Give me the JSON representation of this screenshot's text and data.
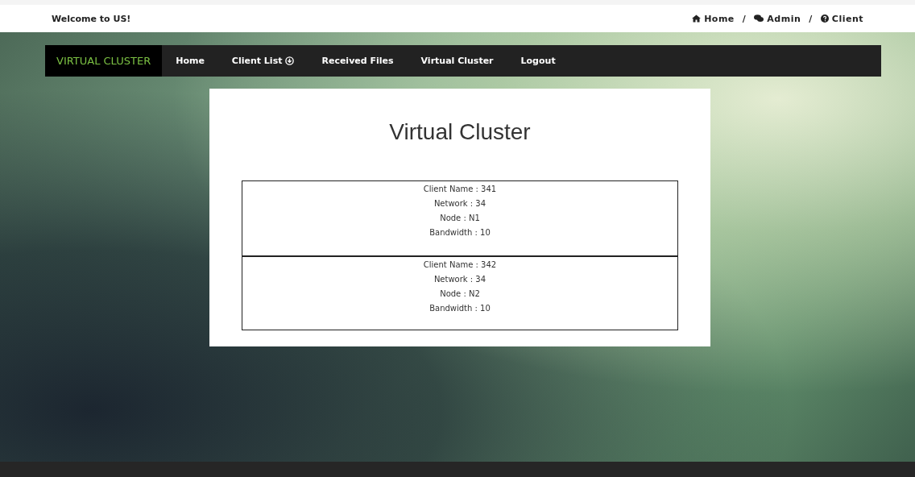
{
  "header": {
    "welcome": "Welcome to US!",
    "separator": "/",
    "breadcrumb": [
      {
        "kind": "home",
        "label": "Home"
      },
      {
        "kind": "chat",
        "label": "Admin"
      },
      {
        "kind": "help",
        "label": "Client"
      }
    ]
  },
  "nav": {
    "brand": "VIRTUAL CLUSTER",
    "items": [
      {
        "label": "Home",
        "kind": "link"
      },
      {
        "label": "Client List",
        "kind": "dropdown"
      },
      {
        "label": "Received Files",
        "kind": "link"
      },
      {
        "label": "Virtual Cluster",
        "kind": "link"
      },
      {
        "label": "Logout",
        "kind": "link"
      }
    ]
  },
  "card": {
    "title": "Virtual Cluster",
    "clients": [
      {
        "lines": [
          "Client Name : 341",
          "Network : 34",
          "Node : N1",
          "Bandwidth : 10"
        ]
      },
      {
        "lines": [
          "Client Name : 342",
          "Network : 34",
          "Node : N2",
          "Bandwidth : 10"
        ]
      }
    ]
  }
}
